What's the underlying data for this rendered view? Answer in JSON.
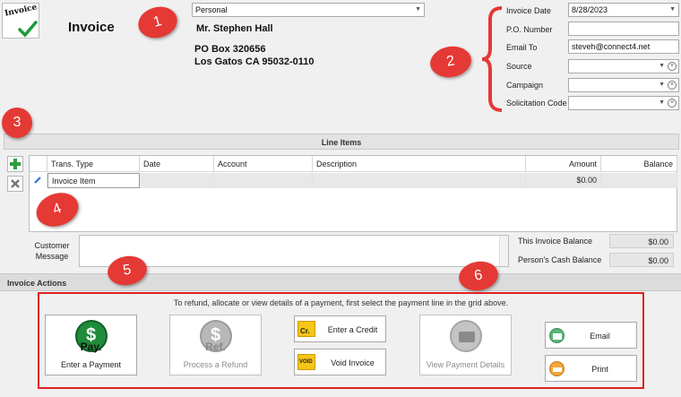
{
  "header": {
    "logo_text": "Invoice",
    "title": "Invoice",
    "profile": "Personal",
    "name": "Mr. Stephen Hall",
    "address1": "PO Box 320656",
    "address2": "Los Gatos  CA  95032-0110"
  },
  "fields": [
    {
      "label": "Invoice Date",
      "value": "8/28/2023",
      "kind": "dropdown"
    },
    {
      "label": "P.O. Number",
      "value": "",
      "kind": "text"
    },
    {
      "label": "Email To",
      "value": "steveh@connect4.net",
      "kind": "text"
    },
    {
      "label": "Source",
      "value": "",
      "kind": "combo-clear"
    },
    {
      "label": "Campaign",
      "value": "",
      "kind": "combo-clear"
    },
    {
      "label": "Solicitation Code",
      "value": "",
      "kind": "combo-clear"
    }
  ],
  "line_items": {
    "title": "Line Items",
    "columns": [
      "Trans. Type",
      "Date",
      "Account",
      "Description",
      "Amount",
      "Balance"
    ],
    "rows": [
      {
        "trans_type": "Invoice Item",
        "date": "",
        "account": "",
        "description": "",
        "amount": "$0.00",
        "balance": ""
      }
    ]
  },
  "message": {
    "label_line1": "Customer",
    "label_line2": "Message",
    "value": ""
  },
  "balances": {
    "this_invoice_label": "This Invoice Balance",
    "this_invoice_value": "$0.00",
    "cash_label": "Person's Cash Balance",
    "cash_value": "$0.00"
  },
  "actions": {
    "title": "Invoice Actions",
    "hint": "To refund, allocate or view details of a payment, first select the payment line in the grid above.",
    "enter_payment": "Enter a Payment",
    "enter_payment_icon_text": "Pay.",
    "process_refund": "Process a Refund",
    "process_refund_icon_text": "Ref.",
    "enter_credit": "Enter a Credit",
    "enter_credit_icon_text": "Cr.",
    "void_invoice": "Void Invoice",
    "void_invoice_icon_text": "VOID",
    "view_payment_details": "View Payment Details",
    "email": "Email",
    "print": "Print"
  },
  "callouts": [
    "1",
    "2",
    "3",
    "4",
    "5",
    "6"
  ],
  "icons": {
    "dropdown": "chevron-down-icon",
    "clear": "clear-circle-x-icon",
    "add": "plus-icon",
    "delete": "x-icon",
    "edit": "pencil-icon",
    "dollar": "dollar-icon",
    "card": "credit-card-icon",
    "email": "envelope-icon",
    "print": "printer-icon"
  },
  "colors": {
    "accent_red": "#e53935",
    "pay_green": "#1f8b3b",
    "credit_yellow": "#f5c518"
  }
}
